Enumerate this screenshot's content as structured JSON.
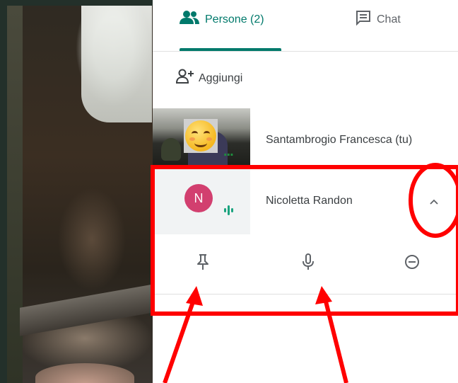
{
  "tabs": {
    "people_label": "Persone (2)",
    "chat_label": "Chat"
  },
  "add_label": "Aggiungi",
  "participants": [
    {
      "name": "Santambrogio Francesca (tu)",
      "more_indicator": "..."
    },
    {
      "name": "Nicoletta Randon",
      "avatar_initial": "N",
      "avatar_color": "#d23f6f"
    }
  ],
  "icons": {
    "people": "people-icon",
    "chat": "chat-icon",
    "add_person": "add-person-icon",
    "collapse": "chevron-up-icon",
    "pin": "pin-icon",
    "mic": "microphone-icon",
    "remove": "remove-circle-icon",
    "speaking": "audio-level-icon"
  },
  "colors": {
    "accent": "#00796b",
    "annotation": "#ff0000",
    "speaking": "#1aa37e"
  }
}
